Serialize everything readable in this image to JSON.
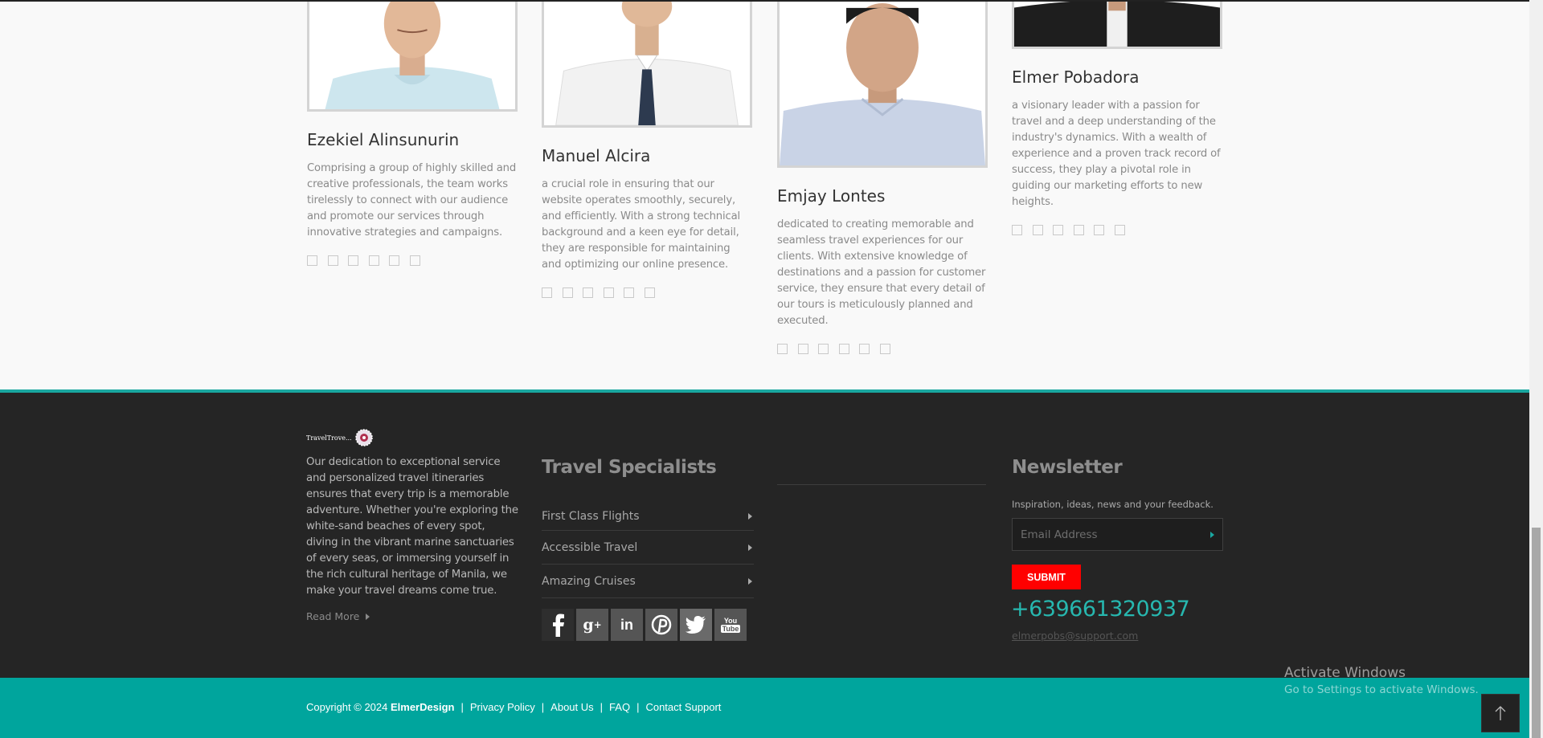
{
  "team": [
    {
      "name": "Ezekiel Alinsunurin",
      "desc": "Comprising a group of highly skilled and creative professionals, the team works tirelessly to connect with our audience and promote our services through innovative strategies and campaigns.",
      "shirt": "#cde6ee"
    },
    {
      "name": "Manuel Alcira",
      "desc": "a crucial role in ensuring that our website operates smoothly, securely, and efficiently. With a strong technical background and a keen eye for detail, they are responsible for maintaining and optimizing our online presence.",
      "shirt": "#f4f4f4"
    },
    {
      "name": "Emjay Lontes",
      "desc": "dedicated to creating memorable and seamless travel experiences for our clients. With extensive knowledge of destinations and a passion for customer service, they ensure that every detail of our tours is meticulously planned and executed.",
      "shirt": "#c9d3e6"
    },
    {
      "name": "Elmer Pobadora",
      "desc": "a visionary leader with a passion for travel and a deep understanding of the industry's dynamics. With a wealth of experience and a proven track record of success, they play a pivotal role in guiding our marketing efforts to new heights.",
      "shirt": "#1e1e1e"
    }
  ],
  "footer": {
    "logo_text": "TravelTrove...",
    "about": "Our dedication to exceptional service and personalized travel itineraries ensures that every trip is a memorable adventure. Whether you're exploring the white-sand beaches of every spot, diving in the vibrant marine sanctuaries of every seas, or immersing yourself in the rich cultural heritage of Manila, we make your travel dreams come true.",
    "read_more": "Read More",
    "specialists_title": "Travel Specialists",
    "links": [
      "First Class Flights",
      "Accessible Travel",
      "Amazing Cruises"
    ],
    "social": [
      {
        "icon": "facebook-icon",
        "glyph": "f"
      },
      {
        "icon": "google-plus-icon",
        "glyph": "g+"
      },
      {
        "icon": "linkedin-icon",
        "glyph": "in"
      },
      {
        "icon": "pinterest-icon",
        "glyph": "P"
      },
      {
        "icon": "twitter-icon",
        "glyph": "t"
      },
      {
        "icon": "youtube-icon",
        "glyph": "You Tube"
      }
    ],
    "newsletter_title": "Newsletter",
    "newsletter_text": "Inspiration, ideas, news and your feedback.",
    "email_placeholder": "Email Address",
    "submit_label": "SUBMIT",
    "phone": "+639661320937",
    "email": "elmerpobs@support.com"
  },
  "bottom": {
    "copyright_prefix": "Copyright © 2024",
    "brand": "ElmerDesign",
    "links": [
      "Privacy Policy",
      "About Us",
      "FAQ",
      "Contact Support"
    ],
    "separator": "|"
  },
  "watermark": {
    "line1": "Activate Windows",
    "line2": "Go to Settings to activate Windows."
  },
  "colors": {
    "accent": "#00a59d",
    "submit": "#ff0000",
    "footer_bg": "#252525"
  }
}
